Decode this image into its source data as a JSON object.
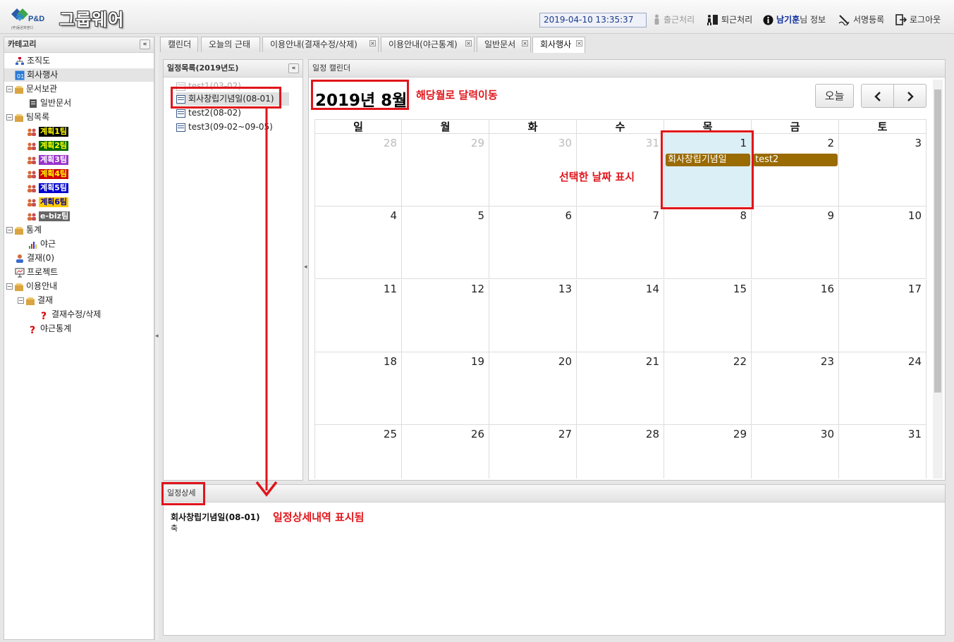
{
  "header": {
    "brand": "그룹웨어",
    "logo_text": "P&D",
    "logo_sub": "(주)동원피엔디",
    "datetime": "2019-04-10 13:35:37",
    "clock_in": "출근처리",
    "clock_out": "퇴근처리",
    "user_name": "남기훈",
    "user_suffix": "님 정보",
    "signature": "서명등록",
    "logout": "로그아웃"
  },
  "sidebar": {
    "title": "카테고리",
    "collapse": "«",
    "items": [
      {
        "label": "조직도"
      },
      {
        "label": "회사행사"
      },
      {
        "label": "문서보관"
      },
      {
        "label": "일반문서"
      },
      {
        "label": "팀목록"
      },
      {
        "label": "계획1팀",
        "bg": "#000000",
        "fg": "#ffff00"
      },
      {
        "label": "계획2팀",
        "bg": "#006600",
        "fg": "#ffff00"
      },
      {
        "label": "계획3팀",
        "bg": "#9933cc",
        "fg": "#ffffff"
      },
      {
        "label": "계획4팀",
        "bg": "#cc0000",
        "fg": "#ffff00"
      },
      {
        "label": "계획5팀",
        "bg": "#0000cc",
        "fg": "#ffffff"
      },
      {
        "label": "계획6팀",
        "bg": "#ffcc00",
        "fg": "#0000aa"
      },
      {
        "label": "e-biz팀",
        "bg": "#666666",
        "fg": "#ffffff"
      },
      {
        "label": "통계"
      },
      {
        "label": "야근"
      },
      {
        "label": "결재(0)"
      },
      {
        "label": "프로젝트"
      },
      {
        "label": "이용안내"
      },
      {
        "label": "결재"
      },
      {
        "label": "결재수정/삭제"
      },
      {
        "label": "야근통계"
      }
    ]
  },
  "tabs": [
    {
      "label": "캘린더",
      "closable": false
    },
    {
      "label": "오늘의 근태",
      "closable": false
    },
    {
      "label": "이용안내(결재수정/삭제)",
      "closable": true
    },
    {
      "label": "이용안내(야근통계)",
      "closable": true
    },
    {
      "label": "일반문서",
      "closable": true
    },
    {
      "label": "회사행사",
      "closable": true,
      "active": true
    }
  ],
  "schedule_list": {
    "title": "일정목록(2019년도)",
    "items": [
      {
        "label": "test1(03-02)"
      },
      {
        "label": "회사창립기념일(08-01)"
      },
      {
        "label": "test2(08-02)"
      },
      {
        "label": "test3(09-02~09-05)"
      }
    ]
  },
  "calendar": {
    "title": "일정 캘린더",
    "month_title": "2019년 8월",
    "today_button": "오늘",
    "weekdays": [
      "일",
      "월",
      "화",
      "수",
      "목",
      "금",
      "토"
    ],
    "weeks": [
      [
        {
          "d": "28",
          "other": true
        },
        {
          "d": "29",
          "other": true
        },
        {
          "d": "30",
          "other": true
        },
        {
          "d": "31",
          "other": true
        },
        {
          "d": "1",
          "selected": true
        },
        {
          "d": "2"
        },
        {
          "d": "3"
        }
      ],
      [
        {
          "d": "4"
        },
        {
          "d": "5"
        },
        {
          "d": "6"
        },
        {
          "d": "7"
        },
        {
          "d": "8"
        },
        {
          "d": "9"
        },
        {
          "d": "10"
        }
      ],
      [
        {
          "d": "11"
        },
        {
          "d": "12"
        },
        {
          "d": "13"
        },
        {
          "d": "14"
        },
        {
          "d": "15"
        },
        {
          "d": "16"
        },
        {
          "d": "17"
        }
      ],
      [
        {
          "d": "18"
        },
        {
          "d": "19"
        },
        {
          "d": "20"
        },
        {
          "d": "21"
        },
        {
          "d": "22"
        },
        {
          "d": "23"
        },
        {
          "d": "24"
        }
      ],
      [
        {
          "d": "25"
        },
        {
          "d": "26"
        },
        {
          "d": "27"
        },
        {
          "d": "28"
        },
        {
          "d": "29"
        },
        {
          "d": "30"
        },
        {
          "d": "31"
        }
      ]
    ],
    "events": [
      {
        "label": "회사창립기념일",
        "week": 0,
        "day": 4,
        "color": "#9a6b00"
      },
      {
        "label": "test2",
        "week": 0,
        "day": 5,
        "color": "#9a6b00"
      }
    ]
  },
  "detail": {
    "title": "일정상세",
    "item_title": "회사창립기념일(08-01)",
    "item_body": "축"
  },
  "annotations": {
    "month_move": "해당월로 달력이동",
    "selected_date": "선택한 날짜 표시",
    "detail_shown": "일정상세내역 표시됨",
    "color": "#e0151b"
  }
}
